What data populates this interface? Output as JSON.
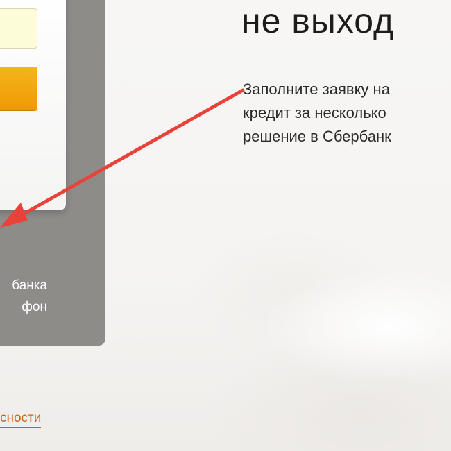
{
  "background": {
    "page_color": "#f6f5f3",
    "panel_color": "#8e8c89"
  },
  "form": {
    "phone_input_value": "",
    "phone_input_placeholder": "",
    "submit_label": "",
    "input_color": "#fdfcd8",
    "button_color": "#f29f0a"
  },
  "panel": {
    "text_lines": [
      "банка",
      "фон"
    ]
  },
  "footer": {
    "security_link_label": "сности",
    "link_color": "#d35f10"
  },
  "hero": {
    "headline": "не выход",
    "paragraph_lines": [
      "Заполните заявку на",
      "кредит за несколько",
      "решение в Сбербанк"
    ]
  },
  "annotation": {
    "arrow_color": "#e8423a",
    "arrow_icon": "red-arrow-icon"
  }
}
